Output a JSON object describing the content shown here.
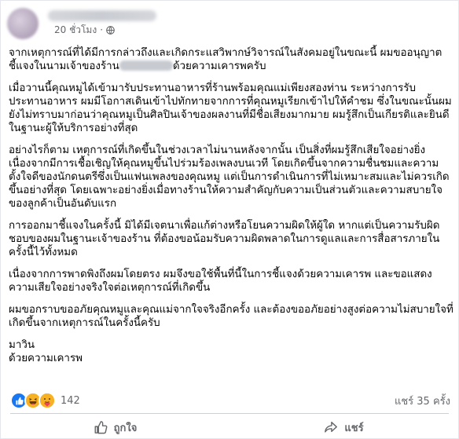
{
  "post": {
    "timestamp": "20 ชั่วโมง",
    "paragraphs": [
      {
        "before": "จากเหตุการณ์ที่ได้มีการกล่าวถึงและเกิดกระแสวิพากษ์วิจารณ์ในสังคมอยู่ในขณะนี้ ผมขออนุญาตชี้แจงในนามเจ้าของร้าน",
        "after": "ด้วยความเคารพครับ"
      },
      "เมื่อวานนี้คุณหมูได้เข้ามารับประทานอาหารที่ร้านพร้อมคุณแม่เพียงสองท่าน ระหว่างการรับประทานอาหาร ผมมีโอกาสเดินเข้าไปทักทายจากการที่คุณหมูเรียกเข้าไปให้คำชม ซึ่งในขณะนั้นผมยังไม่ทราบมาก่อนว่าคุณหมูเป็นศิลปินเจ้าของผลงานที่มีชื่อเสียงมากมาย ผมรู้สึกเป็นเกียรติและยินดีในฐานะผู้ให้บริการอย่างที่สุด",
      "อย่างไรก็ตาม เหตุการณ์ที่เกิดขึ้นในช่วงเวลาไม่นานหลังจากนั้น เป็นสิ่งที่ผมรู้สึกเสียใจอย่างยิ่ง เนื่องจากมีการเชื้อเชิญให้คุณหมูขึ้นไปร่วมร้องเพลงบนเวที โดยเกิดขึ้นจากความชื่นชมและความตั้งใจดีของนักดนตรีซึ่งเป็นแฟนเพลงของคุณหมู แต่เป็นการดำเนินการที่ไม่เหมาะสมและไม่ควรเกิดขึ้นอย่างที่สุด โดยเฉพาะอย่างยิ่งเมื่อทางร้านให้ความสำคัญกับความเป็นส่วนตัวและความสบายใจของลูกค้าเป็นอันดับแรก",
      "การออกมาชี้แจงในครั้งนี้ มิได้มีเจตนาเพื่อแก้ต่างหรือโยนความผิดให้ผู้ใด หากแต่เป็นความรับผิดชอบของผมในฐานะเจ้าของร้าน ที่ต้องขอน้อมรับความผิดพลาดในการดูแลและการสื่อสารภายในครั้งนี้ไว้ทั้งหมด",
      "เนื่องจากการพาดพิงถึงผมโดยตรง ผมจึงขอใช้พื้นที่นี้ในการชี้แจงด้วยความเคารพ และขอแสดงความเสียใจอย่างจริงใจต่อเหตุการณ์ที่เกิดขึ้น",
      "ผมขอกราบขออภัยคุณหมูและคุณแม่จากใจจริงอีกครั้ง และต้องขออภัยอย่างสูงต่อความไม่สบายใจที่เกิดขึ้นจากเหตุการณ์ในครั้งนี้ครับ"
    ],
    "signoff_name": "มาวิน",
    "signoff_closing": "ด้วยความเคารพ"
  },
  "reactions": {
    "count": "142",
    "shares": "แชร์ 35 ครั้ง",
    "emojis": [
      "like",
      "haha",
      "care"
    ]
  },
  "actions": {
    "like_label": "ถูกใจ",
    "share_label": "แชร์"
  },
  "colors": {
    "like_blue": "#1877f2",
    "meta_gray": "#65676b"
  }
}
